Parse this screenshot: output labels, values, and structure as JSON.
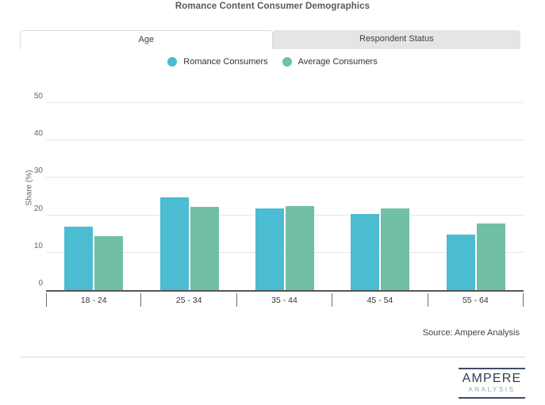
{
  "title": "Romance Content Consumer Demographics",
  "tabs": [
    {
      "label": "Age",
      "active": true
    },
    {
      "label": "Respondent Status",
      "active": false
    }
  ],
  "legend": [
    {
      "label": "Romance Consumers",
      "color": "#4bbcd2"
    },
    {
      "label": "Average Consumers",
      "color": "#72bfa7"
    }
  ],
  "chart_data": {
    "type": "bar",
    "categories": [
      "18 - 24",
      "25 - 34",
      "35 - 44",
      "45 - 54",
      "55 - 64"
    ],
    "series": [
      {
        "name": "Romance Consumers",
        "color": "#4bbcd2",
        "values": [
          17,
          24.7,
          21.8,
          20.4,
          14.9
        ]
      },
      {
        "name": "Average Consumers",
        "color": "#72bfa7",
        "values": [
          14.5,
          22.3,
          22.4,
          21.9,
          17.8
        ]
      }
    ],
    "title": "Romance Content Consumer Demographics",
    "xlabel": "",
    "ylabel": "Share (%)",
    "yticks": [
      0,
      10,
      20,
      30,
      40,
      50
    ],
    "ylim": [
      0,
      50
    ],
    "grid": true,
    "legend_position": "top"
  },
  "source": "Source: Ampere Analysis",
  "logo": {
    "name": "AMPERE",
    "subname": "ANALYSIS"
  }
}
